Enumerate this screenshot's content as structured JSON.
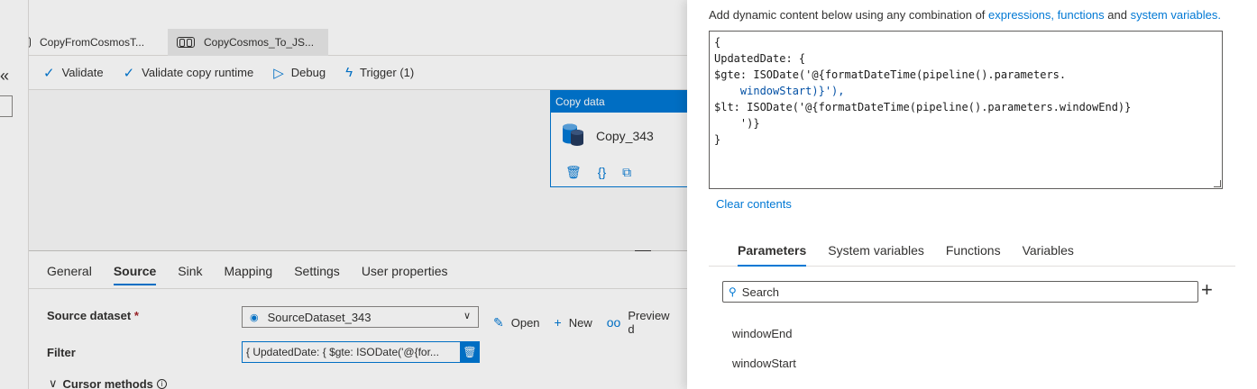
{
  "tabs": [
    {
      "label": "CopyFromCosmosT..."
    },
    {
      "label": "CopyCosmos_To_JS..."
    }
  ],
  "collapse_glyph": "«",
  "toolbar": {
    "validate": "Validate",
    "validate_runtime": "Validate copy runtime",
    "debug": "Debug",
    "trigger": "Trigger (1)"
  },
  "activity": {
    "type_label": "Copy data",
    "name": "Copy_343"
  },
  "bottom_tabs": [
    "General",
    "Source",
    "Sink",
    "Mapping",
    "Settings",
    "User properties"
  ],
  "source": {
    "dataset_label": "Source dataset",
    "required_mark": "*",
    "dataset_value": "SourceDataset_343",
    "open": "Open",
    "new": "New",
    "preview": "Preview d",
    "filter_label": "Filter",
    "filter_value": "{ UpdatedDate: { $gte: ISODate('@{for...",
    "cursor_label": "Cursor methods"
  },
  "panel": {
    "hint_prefix": "Add dynamic content below using any combination of ",
    "hint_link1": "expressions, functions",
    "hint_mid": " and ",
    "hint_link2": "system variables.",
    "code_lines": [
      "{",
      "UpdatedDate: {",
      "$gte: ISODate('@{formatDateTime(pipeline().parameters.",
      "    windowStart)}'),",
      "$lt: ISODate('@{formatDateTime(pipeline().parameters.windowEnd)}",
      "    ')}",
      "}"
    ],
    "clear": "Clear contents",
    "tabs": [
      "Parameters",
      "System variables",
      "Functions",
      "Variables"
    ],
    "search_placeholder": "Search",
    "params": [
      "windowEnd",
      "windowStart"
    ]
  },
  "colors": {
    "accent": "#0078d4"
  }
}
